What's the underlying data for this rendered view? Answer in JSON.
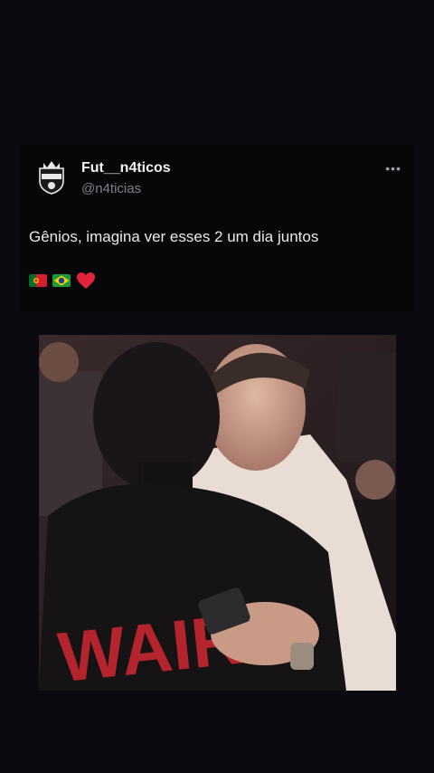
{
  "post": {
    "author_name": "Fut__n4ticos",
    "author_handle": "@n4ticias",
    "more_label": "•••",
    "text": "Gênios, imagina ver esses 2 um dia juntos",
    "emojis": [
      "flag-portugal-icon",
      "flag-brazil-icon",
      "red-heart-icon"
    ]
  },
  "media": {
    "shirt_text": "WAIR"
  },
  "colors": {
    "background": "#0c0a10",
    "card": "#070609",
    "handle": "#7d8288",
    "heart": "#e0243a"
  }
}
